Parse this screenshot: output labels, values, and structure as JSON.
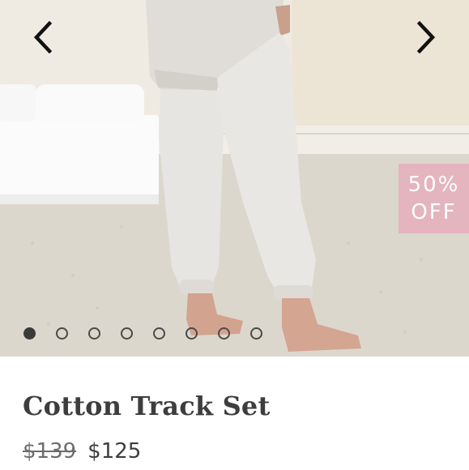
{
  "carousel": {
    "prev_icon": "chevron-left-icon",
    "next_icon": "chevron-right-icon",
    "image_alt": "Model wearing light grey cotton track pants in a bedroom",
    "slide_count": 8,
    "active_slide": 1
  },
  "badge": {
    "line1": "50%",
    "line2": "OFF",
    "color": "#e4b4bf"
  },
  "product": {
    "title": "Cotton Track Set",
    "original_price": "$139",
    "sale_price": "$125"
  }
}
